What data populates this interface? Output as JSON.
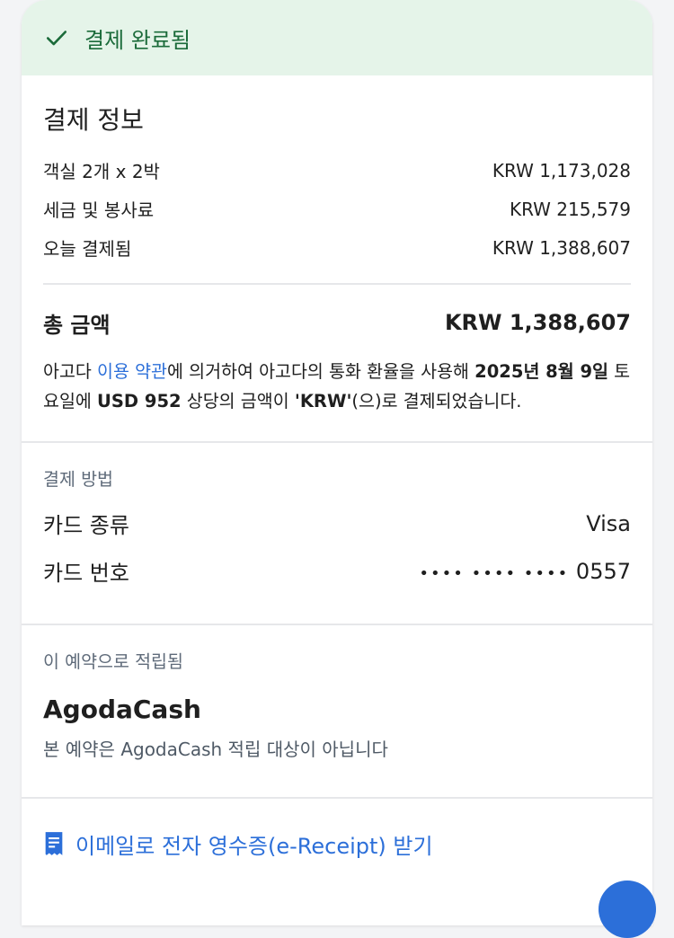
{
  "banner": {
    "title": "결제 완료됨",
    "check_icon": "check-icon",
    "color": "#1b6b3a"
  },
  "payment_info": {
    "title": "결제 정보",
    "rows": [
      {
        "label": "객실 2개 x 2박",
        "value": "KRW 1,173,028"
      },
      {
        "label": "세금 및 봉사료",
        "value": "KRW 215,579"
      },
      {
        "label": "오늘 결제됨",
        "value": "KRW 1,388,607"
      }
    ],
    "total_label": "총 금액",
    "total_value": "KRW 1,388,607",
    "note": {
      "prefix": "아고다 ",
      "link": "이용 약관",
      "mid1": "에 의거하여 아고다의 통화 환율을 사용해 ",
      "date": "2025년 8월 9일",
      "mid2": " 토요일에 ",
      "usd": "USD 952",
      "mid3": " 상당의 금액이 ",
      "krw": "'KRW'",
      "suffix": "(으)로 결제되었습니다."
    }
  },
  "payment_method": {
    "title": "결제 방법",
    "rows": [
      {
        "label": "카드 종류",
        "value": "Visa"
      },
      {
        "label": "카드 번호",
        "dots": "•••• •••• ••••",
        "value": "0557"
      }
    ]
  },
  "rewards": {
    "title": "이 예약으로 적립됨",
    "name": "AgodaCash",
    "desc": "본 예약은 AgodaCash 적립 대상이 아닙니다"
  },
  "receipt": {
    "label": "이메일로 전자 영수증(e-Receipt) 받기",
    "icon": "receipt-icon"
  },
  "colors": {
    "accent": "#2c6fd9",
    "banner_bg": "#e5f4e9"
  }
}
